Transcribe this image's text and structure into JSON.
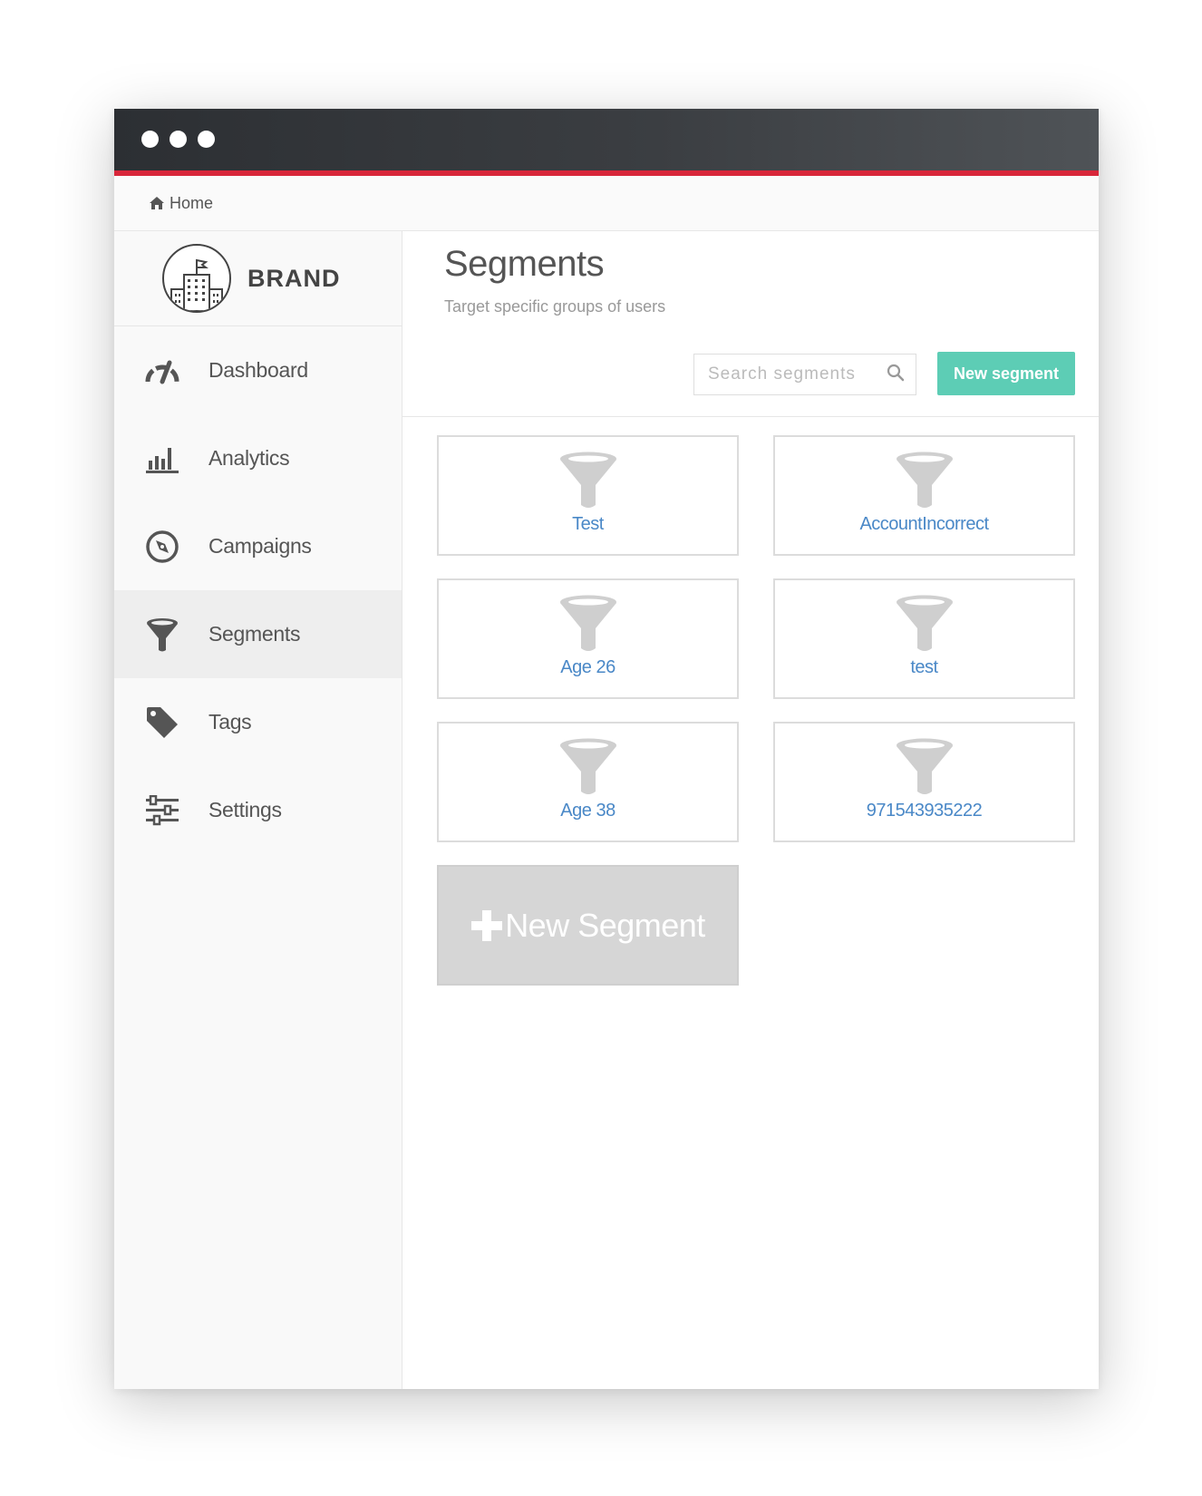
{
  "breadcrumb": {
    "home_label": "Home"
  },
  "brand": {
    "name": "BRAND"
  },
  "sidebar": {
    "items": [
      {
        "label": "Dashboard",
        "icon": "speedometer-icon",
        "active": false
      },
      {
        "label": "Analytics",
        "icon": "bar-chart-icon",
        "active": false
      },
      {
        "label": "Campaigns",
        "icon": "compass-icon",
        "active": false
      },
      {
        "label": "Segments",
        "icon": "funnel-icon",
        "active": true
      },
      {
        "label": "Tags",
        "icon": "tag-icon",
        "active": false
      },
      {
        "label": "Settings",
        "icon": "sliders-icon",
        "active": false
      }
    ]
  },
  "header": {
    "title": "Segments",
    "subtitle": "Target specific groups of users",
    "search_placeholder": "Search segments",
    "new_button_label": "New segment"
  },
  "segments": [
    {
      "label": "Test"
    },
    {
      "label": "AccountIncorrect"
    },
    {
      "label": "Age 26"
    },
    {
      "label": "test"
    },
    {
      "label": "Age 38"
    },
    {
      "label": "971543935222"
    }
  ],
  "new_segment_card": {
    "label": "New Segment"
  },
  "colors": {
    "accent": "#5dcdb5",
    "titlebar_stripe": "#d8263a",
    "link": "#4a88c7"
  }
}
